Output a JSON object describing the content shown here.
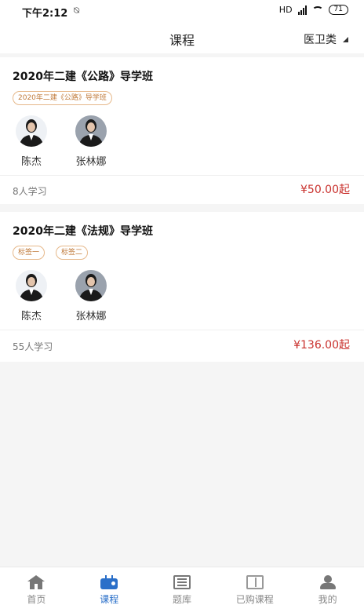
{
  "status_bar": {
    "time": "下午2:12",
    "mute_icon": "vibrate-off-icon",
    "network_label": "HD",
    "battery": "71"
  },
  "header": {
    "title": "课程",
    "category": "医卫类"
  },
  "courses": [
    {
      "title": "2020年二建《公路》导学班",
      "tags": [
        "2020年二建《公路》导学班"
      ],
      "teachers": [
        {
          "name": "陈杰",
          "avatar": "teacher-avatar"
        },
        {
          "name": "张林娜",
          "avatar": "teacher-avatar"
        }
      ],
      "learners": "8人学习",
      "price": "¥50.00起"
    },
    {
      "title": "2020年二建《法规》导学班",
      "tags": [
        "标签一",
        "标签二"
      ],
      "teachers": [
        {
          "name": "陈杰",
          "avatar": "teacher-avatar"
        },
        {
          "name": "张林娜",
          "avatar": "teacher-avatar"
        }
      ],
      "learners": "55人学习",
      "price": "¥136.00起"
    }
  ],
  "tabbar": [
    {
      "label": "首页",
      "icon": "home-icon",
      "active": false
    },
    {
      "label": "课程",
      "icon": "tv-icon",
      "active": true
    },
    {
      "label": "题库",
      "icon": "list-icon",
      "active": false
    },
    {
      "label": "已购课程",
      "icon": "book-icon",
      "active": false
    },
    {
      "label": "我的",
      "icon": "user-icon",
      "active": false
    }
  ],
  "colors": {
    "accent": "#2a6fc9",
    "price": "#c9302c",
    "tag_border": "#e6b88a",
    "tag_text": "#c07a3a"
  }
}
